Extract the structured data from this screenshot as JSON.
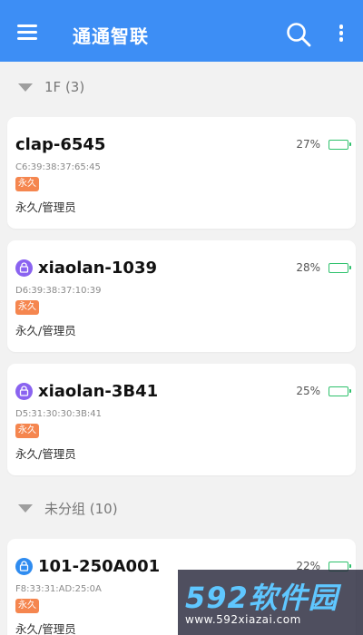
{
  "appbar": {
    "title": "通通智联",
    "menu_icon": "hamburger-menu-icon",
    "search_icon": "search-icon",
    "more_icon": "more-vertical-icon",
    "color": "#3d8ef5"
  },
  "groups": [
    {
      "label": "1F (3)",
      "devices": [
        {
          "name": "clap-6545",
          "mac": "C6:39:38:37:65:45",
          "badge": "永久",
          "permission": "永久/管理员",
          "battery": "27%",
          "battery_level": 27,
          "icon": ""
        },
        {
          "name": "xiaolan-1039",
          "mac": "D6:39:38:37:10:39",
          "badge": "永久",
          "permission": "永久/管理员",
          "battery": "28%",
          "battery_level": 28,
          "icon": "lock-icon",
          "icon_color": "#8a63f0"
        },
        {
          "name": "xiaolan-3B41",
          "mac": "D5:31:30:30:3B:41",
          "badge": "永久",
          "permission": "永久/管理员",
          "battery": "25%",
          "battery_level": 25,
          "icon": "lock-icon",
          "icon_color": "#8a63f0"
        }
      ]
    },
    {
      "label": "未分组 (10)",
      "devices": [
        {
          "name": "101-250A001",
          "mac": "F8:33:31:AD:25:0A",
          "badge": "永久",
          "permission": "永久/管理员",
          "battery": "22%",
          "battery_level": 22,
          "icon": "lock-icon",
          "icon_color": "#2f8cf0"
        }
      ]
    }
  ],
  "watermark": {
    "brand": "592软件园",
    "url": "www.592xiazai.com"
  },
  "colors": {
    "badge": "#f5864f",
    "battery": "#2ec16c",
    "background": "#f2f2f2"
  }
}
